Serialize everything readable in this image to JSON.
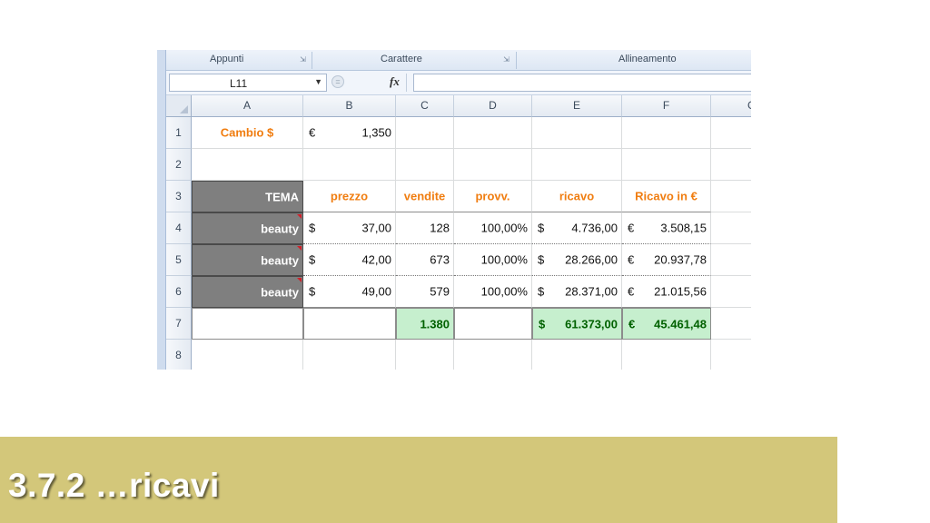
{
  "ribbon": {
    "groups": [
      "Appunti",
      "Carattere",
      "Allineamento"
    ]
  },
  "formula_bar": {
    "name_box": "L11",
    "fx_label": "fx",
    "formula": ""
  },
  "columns": [
    "A",
    "B",
    "C",
    "D",
    "E",
    "F",
    "G"
  ],
  "rows": [
    "1",
    "2",
    "3",
    "4",
    "5",
    "6",
    "7",
    "8"
  ],
  "cells": {
    "r1": {
      "A": "Cambio $",
      "B_sym": "€",
      "B": "1,350"
    },
    "r3": {
      "A": "TEMA",
      "B": "prezzo",
      "C": "vendite",
      "D": "provv.",
      "E": "ricavo",
      "F": "Ricavo in €"
    },
    "r4": {
      "A": "beauty",
      "B_sym": "$",
      "B": "37,00",
      "C": "128",
      "D": "100,00%",
      "E_sym": "$",
      "E": "4.736,00",
      "F_sym": "€",
      "F": "3.508,15"
    },
    "r5": {
      "A": "beauty",
      "B_sym": "$",
      "B": "42,00",
      "C": "673",
      "D": "100,00%",
      "E_sym": "$",
      "E": "28.266,00",
      "F_sym": "€",
      "F": "20.937,78"
    },
    "r6": {
      "A": "beauty",
      "B_sym": "$",
      "B": "49,00",
      "C": "579",
      "D": "100,00%",
      "E_sym": "$",
      "E": "28.371,00",
      "F_sym": "€",
      "F": "21.015,56"
    },
    "r7": {
      "C": "1.380",
      "E_sym": "$",
      "E": "61.373,00",
      "F_sym": "€",
      "F": "45.461,48"
    }
  },
  "colors": {
    "orange_text": "#f07d10",
    "header_gray": "#7f7f7f",
    "total_green_bg": "#c6efce",
    "total_green_text": "#006100",
    "banner": "#d3c77a"
  },
  "slide_title": "3.7.2 …ricavi"
}
